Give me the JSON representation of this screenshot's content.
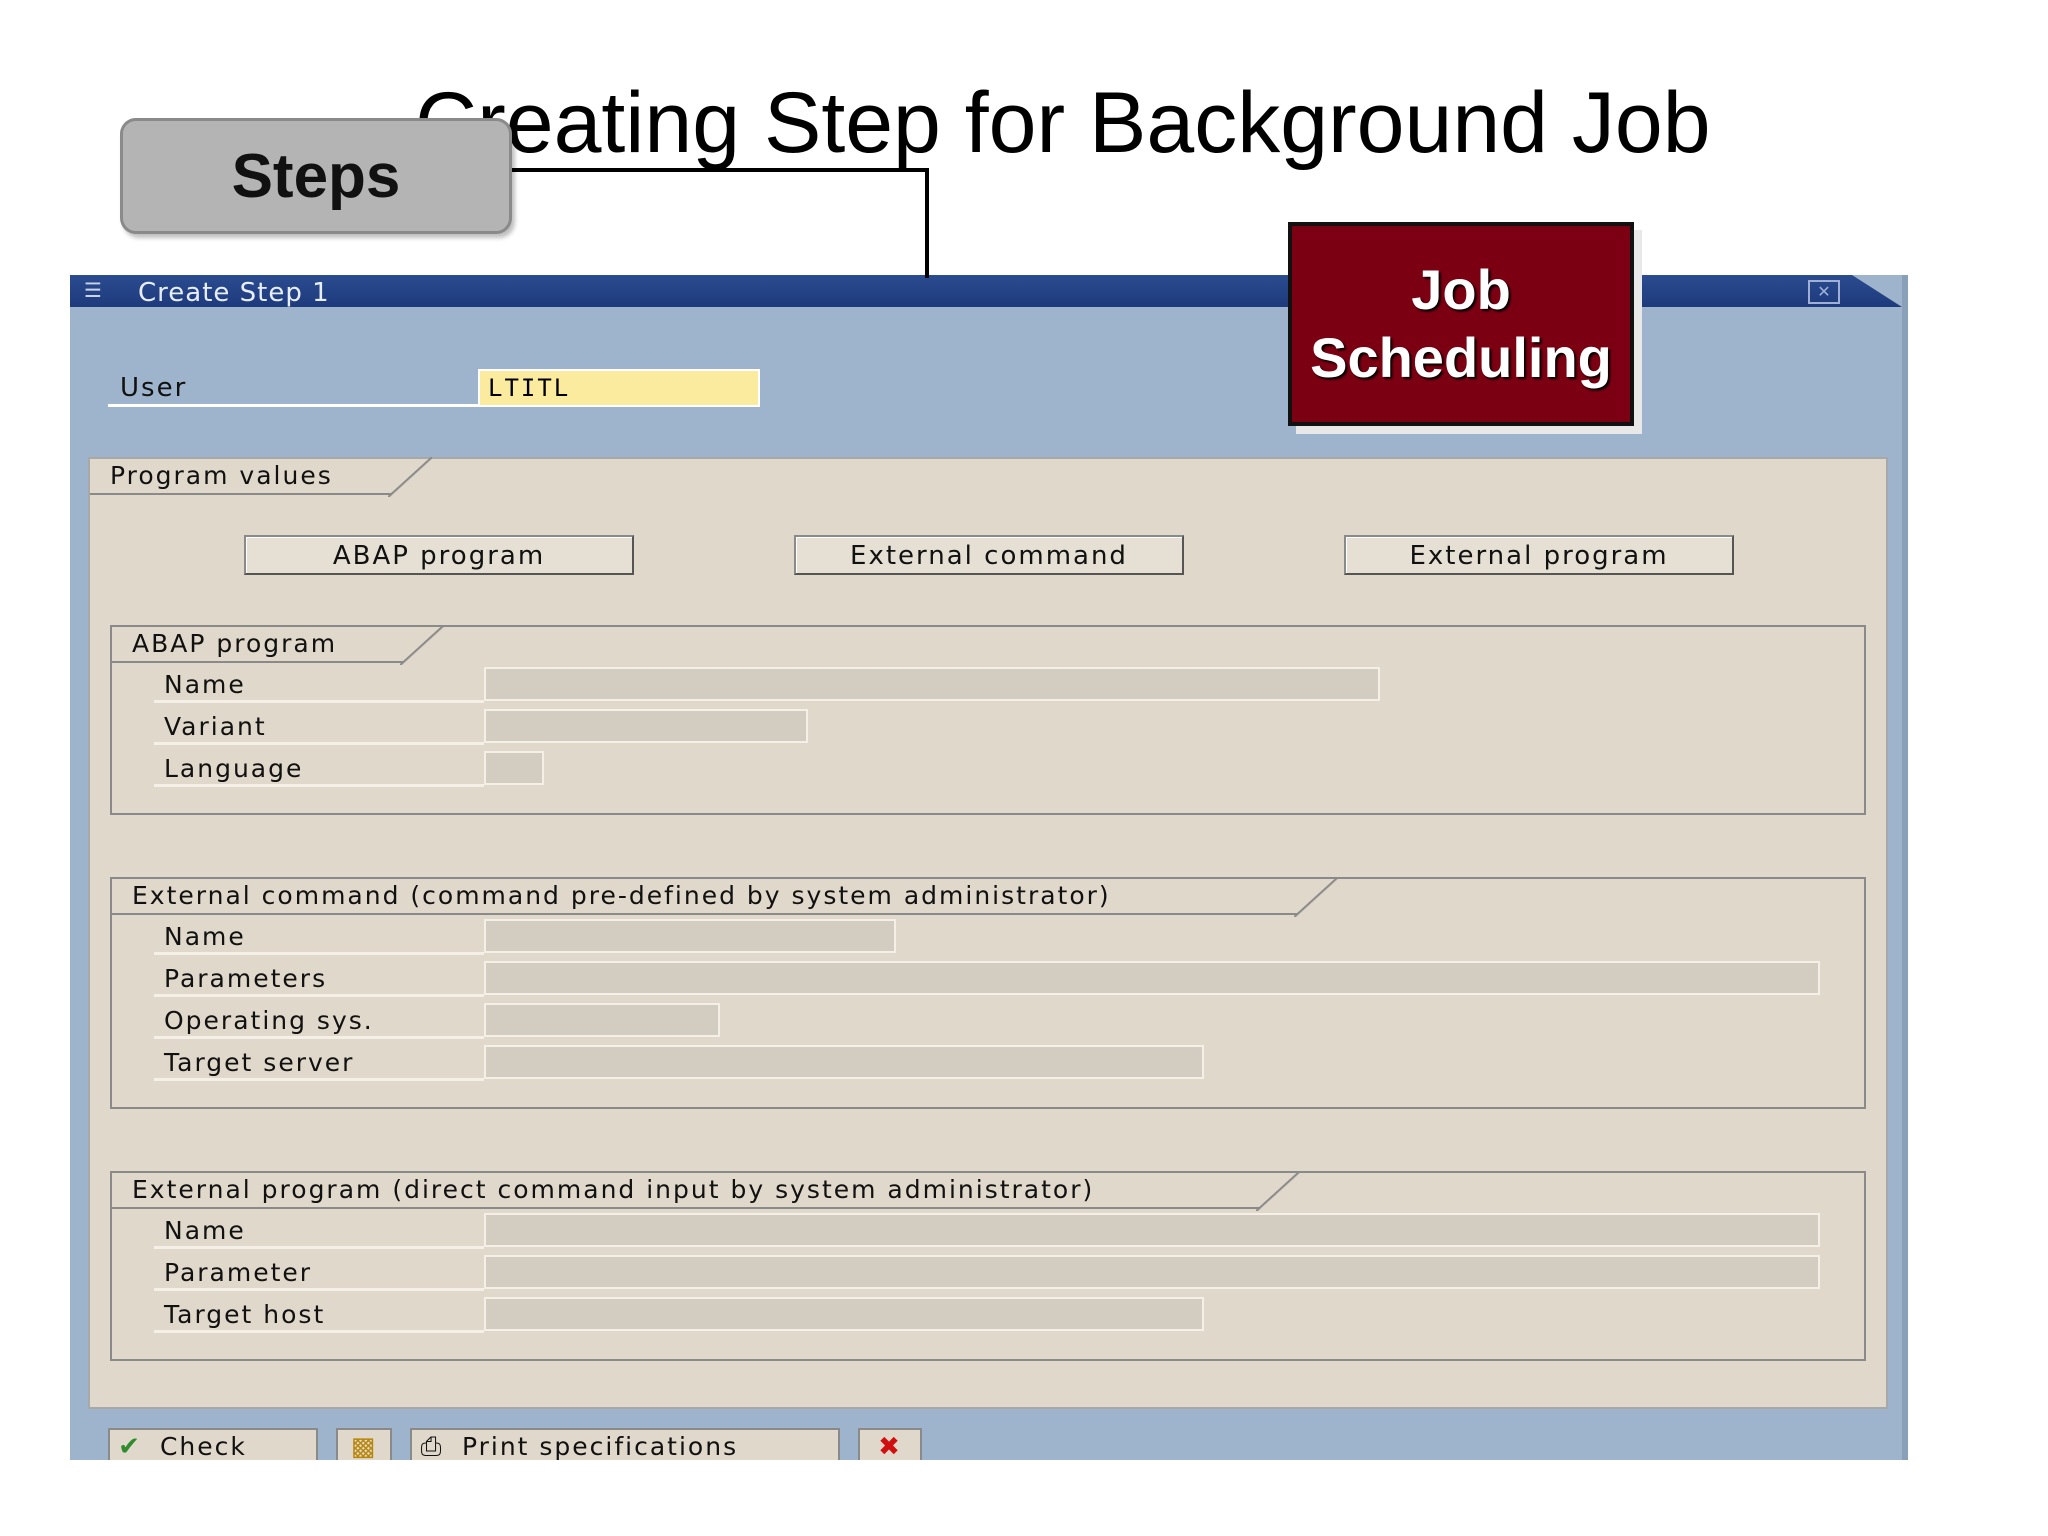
{
  "slide": {
    "title": "Creating Step for Background Job",
    "steps_callout": "Steps",
    "job_callout_line1": "Job",
    "job_callout_line2": "Scheduling"
  },
  "window": {
    "title": "Create Step  1",
    "close_icon": "close-icon"
  },
  "user": {
    "label": "User",
    "value": "LTITL"
  },
  "program_values": {
    "label": "Program values",
    "buttons": [
      "ABAP program",
      "External command",
      "External program"
    ]
  },
  "abap_program": {
    "label": "ABAP program",
    "fields": [
      "Name",
      "Variant",
      "Language"
    ]
  },
  "external_command": {
    "label": "External command (command pre-defined by system administrator)",
    "fields": [
      "Name",
      "Parameters",
      "Operating sys.",
      "Target server"
    ]
  },
  "external_program": {
    "label": "External program (direct command input by system administrator)",
    "fields": [
      "Name",
      "Parameter",
      "Target host"
    ]
  },
  "toolbar": {
    "check_label": "Check",
    "print_label": "Print specifications",
    "icons": [
      "check-icon",
      "save-icon",
      "print-icon",
      "cancel-icon"
    ]
  },
  "colors": {
    "window_bg": "#9db4cc",
    "title_bar": "#1d3a7c",
    "panel_bg": "#e0d8ca",
    "user_field": "#fbeb9e",
    "job_callout": "#7b0012"
  }
}
